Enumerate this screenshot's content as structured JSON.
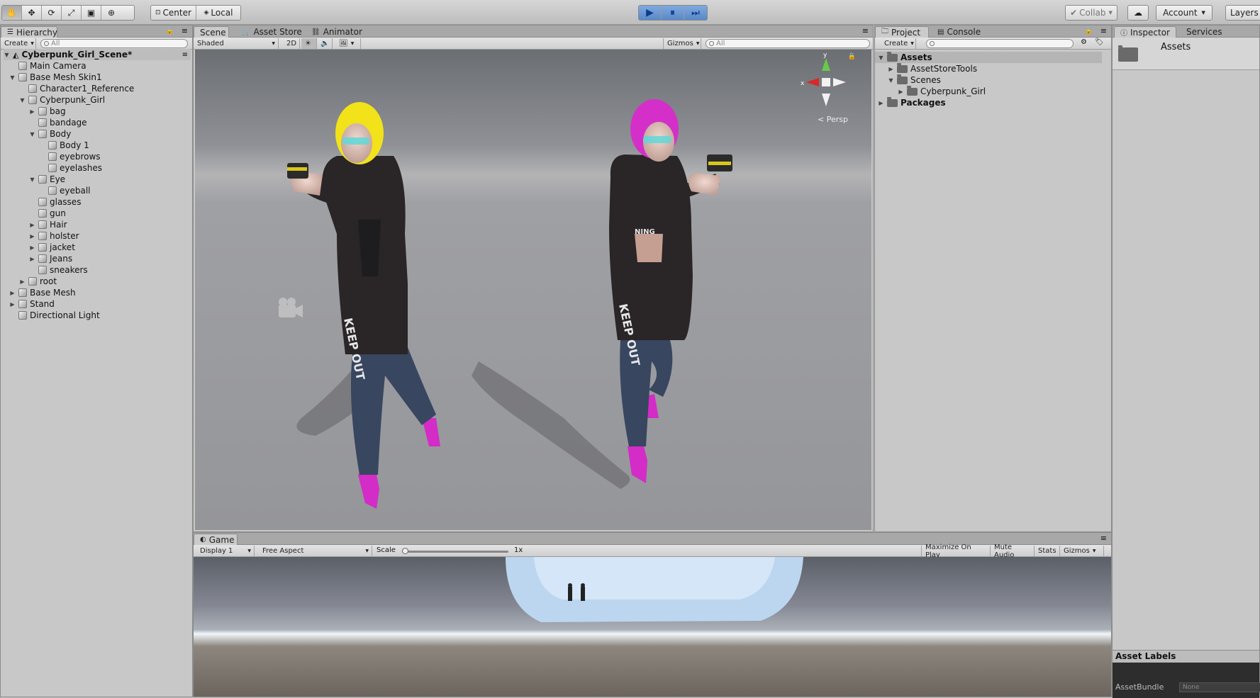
{
  "toolbar": {
    "tools": [
      "hand-icon",
      "move-icon",
      "rotate-icon",
      "scale-icon",
      "rect-icon",
      "transform-icon"
    ],
    "pivot": "Center",
    "space": "Local",
    "collab": "Collab",
    "account": "Account",
    "layers": "Layers"
  },
  "hierarchy": {
    "tab": "Hierarchy",
    "create": "Create",
    "search_placeholder": "All",
    "scene": "Cyberpunk_Girl_Scene*",
    "items": [
      {
        "label": "Main Camera",
        "depth": 0,
        "arrow": ""
      },
      {
        "label": "Base Mesh Skin1",
        "depth": 0,
        "arrow": "▼"
      },
      {
        "label": "Character1_Reference",
        "depth": 1,
        "arrow": ""
      },
      {
        "label": "Cyberpunk_Girl",
        "depth": 1,
        "arrow": "▼"
      },
      {
        "label": "bag",
        "depth": 2,
        "arrow": "▶"
      },
      {
        "label": "bandage",
        "depth": 2,
        "arrow": ""
      },
      {
        "label": "Body",
        "depth": 2,
        "arrow": "▼"
      },
      {
        "label": "Body 1",
        "depth": 3,
        "arrow": ""
      },
      {
        "label": "eyebrows",
        "depth": 3,
        "arrow": ""
      },
      {
        "label": "eyelashes",
        "depth": 3,
        "arrow": ""
      },
      {
        "label": "Eye",
        "depth": 2,
        "arrow": "▼"
      },
      {
        "label": "eyeball",
        "depth": 3,
        "arrow": ""
      },
      {
        "label": "glasses",
        "depth": 2,
        "arrow": ""
      },
      {
        "label": "gun",
        "depth": 2,
        "arrow": ""
      },
      {
        "label": "Hair",
        "depth": 2,
        "arrow": "▶"
      },
      {
        "label": "holster",
        "depth": 2,
        "arrow": "▶"
      },
      {
        "label": "jacket",
        "depth": 2,
        "arrow": "▶"
      },
      {
        "label": "Jeans",
        "depth": 2,
        "arrow": "▶"
      },
      {
        "label": "sneakers",
        "depth": 2,
        "arrow": ""
      },
      {
        "label": "root",
        "depth": 1,
        "arrow": "▶"
      },
      {
        "label": "Base Mesh",
        "depth": 0,
        "arrow": "▶"
      },
      {
        "label": "Stand",
        "depth": 0,
        "arrow": "▶"
      },
      {
        "label": "Directional Light",
        "depth": 0,
        "arrow": ""
      }
    ]
  },
  "scene": {
    "tabs": [
      "Scene",
      "Asset Store",
      "Animator"
    ],
    "shading": "Shaded",
    "mode_2d": "2D",
    "gizmos": "Gizmos",
    "search_placeholder": "All",
    "persp": "Persp",
    "gizmo_axes": [
      "y",
      "x"
    ],
    "text_on_jeans": "KEEP OUT",
    "text_on_top": "NING"
  },
  "project": {
    "tabs": [
      "Project",
      "Console"
    ],
    "create": "Create",
    "tree": [
      {
        "label": "Assets",
        "depth": 0,
        "arrow": "▼",
        "bold": true
      },
      {
        "label": "AssetStoreTools",
        "depth": 1,
        "arrow": "▶",
        "bold": false
      },
      {
        "label": "Scenes",
        "depth": 1,
        "arrow": "▼",
        "bold": false
      },
      {
        "label": "Cyberpunk_Girl",
        "depth": 2,
        "arrow": "▶",
        "bold": false
      },
      {
        "label": "Packages",
        "depth": 0,
        "arrow": "▶",
        "bold": true
      }
    ]
  },
  "inspector": {
    "tabs": [
      "Inspector",
      "Services"
    ],
    "title": "Assets",
    "asset_labels": "Asset Labels",
    "assetbundle_label": "AssetBundle",
    "assetbundle_value": "None"
  },
  "game": {
    "tab": "Game",
    "display": "Display 1",
    "aspect": "Free Aspect",
    "scale_label": "Scale",
    "scale_value": "1x",
    "scale_fraction": 0.0,
    "buttons": [
      "Maximize On Play",
      "Mute Audio",
      "Stats",
      "Gizmos"
    ]
  },
  "colors": {
    "play_blue": "#5a88c8",
    "yellow_hair": "#f2e21a",
    "pink_hair": "#d430c9"
  }
}
